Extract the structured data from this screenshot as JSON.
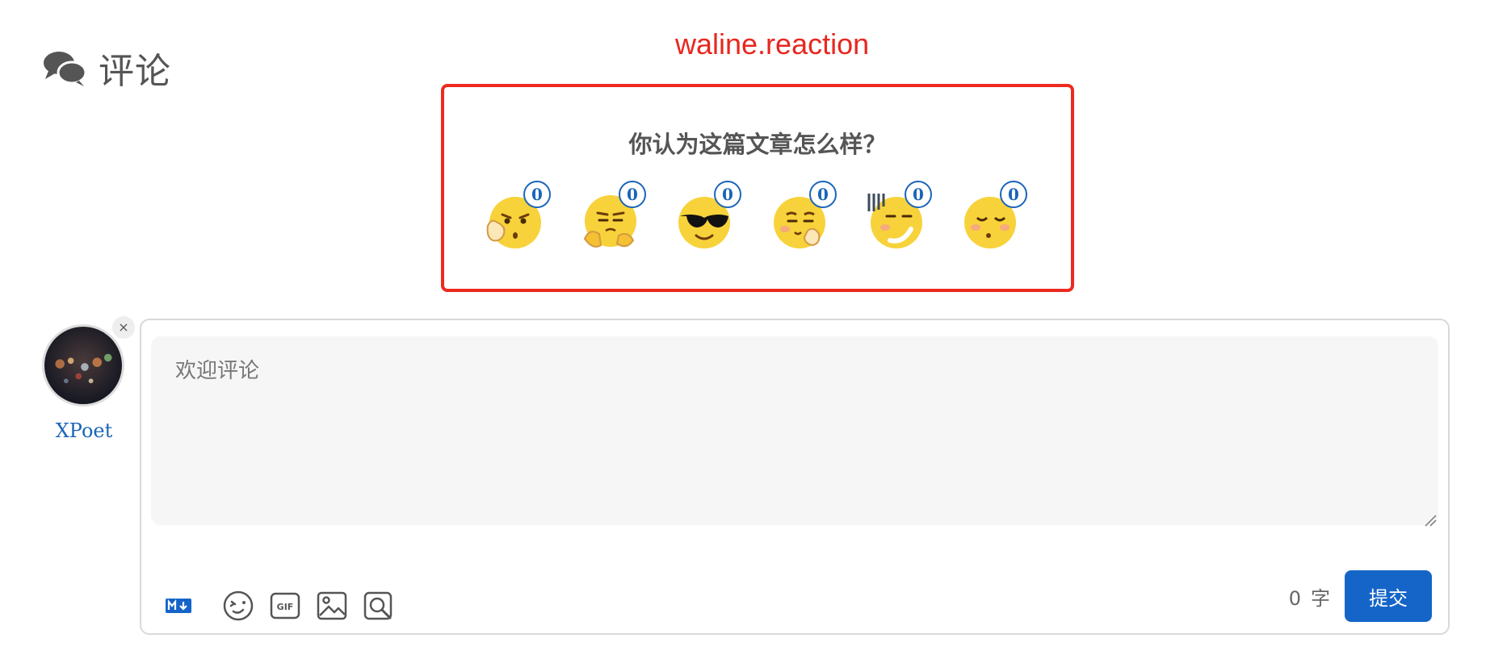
{
  "header": {
    "title": "评论"
  },
  "annotation": "waline.reaction",
  "reaction": {
    "title": "你认为这篇文章怎么样？",
    "items": [
      {
        "icon": "emoji-thinking-icon",
        "count": "0"
      },
      {
        "icon": "emoji-disdain-icon",
        "count": "0"
      },
      {
        "icon": "emoji-cool-sunglasses-icon",
        "count": "0"
      },
      {
        "icon": "emoji-doubt-icon",
        "count": "0"
      },
      {
        "icon": "emoji-speechless-icon",
        "count": "0"
      },
      {
        "icon": "emoji-sleepy-icon",
        "count": "0"
      }
    ]
  },
  "user": {
    "name": "XPoet",
    "close_label": "×"
  },
  "editor": {
    "placeholder": "欢迎评论",
    "toolbar": [
      "markdown-icon",
      "emoji-icon",
      "gif-icon",
      "image-icon",
      "preview-icon"
    ],
    "word_count": "0",
    "word_unit": "字",
    "submit_label": "提交"
  },
  "colors": {
    "accent": "#1565c9",
    "annotation": "#e8271f",
    "count": "#1b65b8"
  }
}
